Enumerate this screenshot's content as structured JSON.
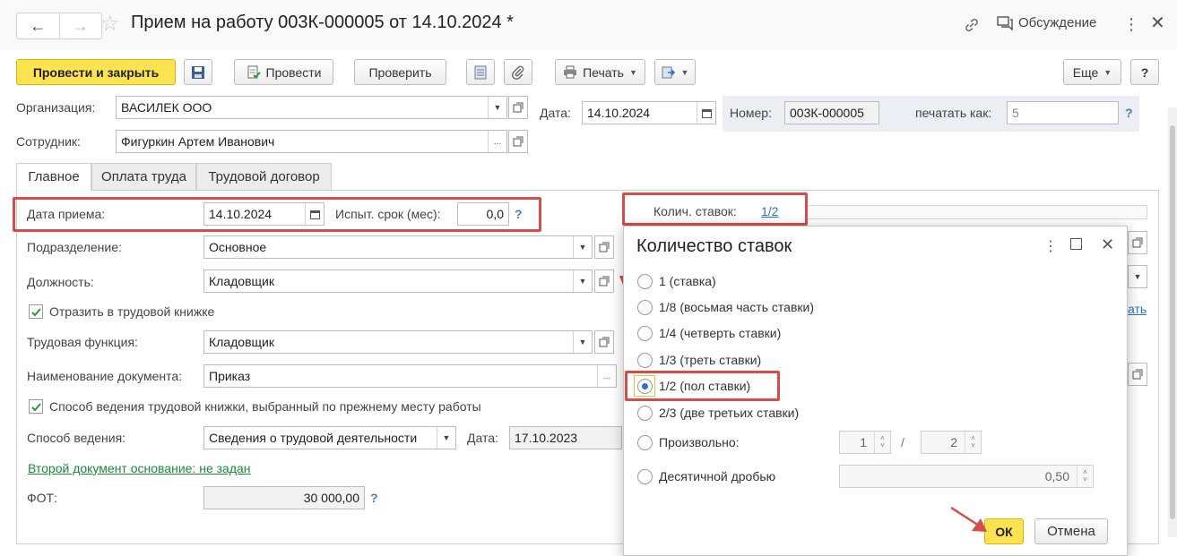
{
  "window": {
    "title": "Прием на работу 003К-000005 от 14.10.2024 *",
    "discuss_label": "Обсуждение",
    "nav_back": "←",
    "nav_forward": "→"
  },
  "toolbar": {
    "post_close": "Провести и закрыть",
    "post": "Провести",
    "check": "Проверить",
    "print": "Печать",
    "more": "Еще",
    "help": "?"
  },
  "header": {
    "org_label": "Организация:",
    "org_value": "ВАСИЛЕК ООО",
    "date_label": "Дата:",
    "date_value": "14.10.2024",
    "number_label": "Номер:",
    "number_value": "003К-000005",
    "print_as_label": "печатать как:",
    "print_as_value": "5",
    "employee_label": "Сотрудник:",
    "employee_value": "Фигуркин Артем Иванович"
  },
  "tabs": [
    "Главное",
    "Оплата труда",
    "Трудовой договор"
  ],
  "main": {
    "hire_date_label": "Дата приема:",
    "hire_date_value": "14.10.2024",
    "probation_label": "Испыт. срок (мес):",
    "probation_value": "0,0",
    "division_label": "Подразделение:",
    "division_value": "Основное",
    "position_label": "Должность:",
    "position_value": "Кладовщик",
    "record_book_label": "Отразить в трудовой книжке",
    "labor_function_label": "Трудовая функция:",
    "labor_function_value": "Кладовщик",
    "doc_name_label": "Наименование документа:",
    "doc_name_value": "Приказ",
    "method_prev_label": "Способ ведения трудовой книжки, выбранный по прежнему месту работы",
    "method_label": "Способ ведения:",
    "method_value": "Сведения о трудовой деятельности",
    "method_date_label": "Дата:",
    "method_date_value": "17.10.2023",
    "second_doc_link": "Второй документ основание: не задан",
    "fot_label": "ФОТ:",
    "fot_value": "30 000,00",
    "rates_label": "Колич. ставок:",
    "rates_value": "1/2",
    "partial_link": "ать"
  },
  "dialog": {
    "title": "Количество ставок",
    "options": [
      "1 (ставка)",
      "1/8 (восьмая часть ставки)",
      "1/4 (четверть ставки)",
      "1/3 (треть ставки)",
      "1/2 (пол ставки)",
      "2/3 (две третьих ставки)",
      "Произвольно:",
      "Десятичной дробью"
    ],
    "selected_index": 4,
    "numerator": "1",
    "divider": "/",
    "denominator": "2",
    "decimal": "0,50",
    "ok": "ОК",
    "cancel": "Отмена"
  },
  "colors": {
    "primary_button": "#fbe351",
    "highlight": "#d84b4b",
    "link_green": "#1a8a3a",
    "help_blue": "#3f7fcf"
  }
}
